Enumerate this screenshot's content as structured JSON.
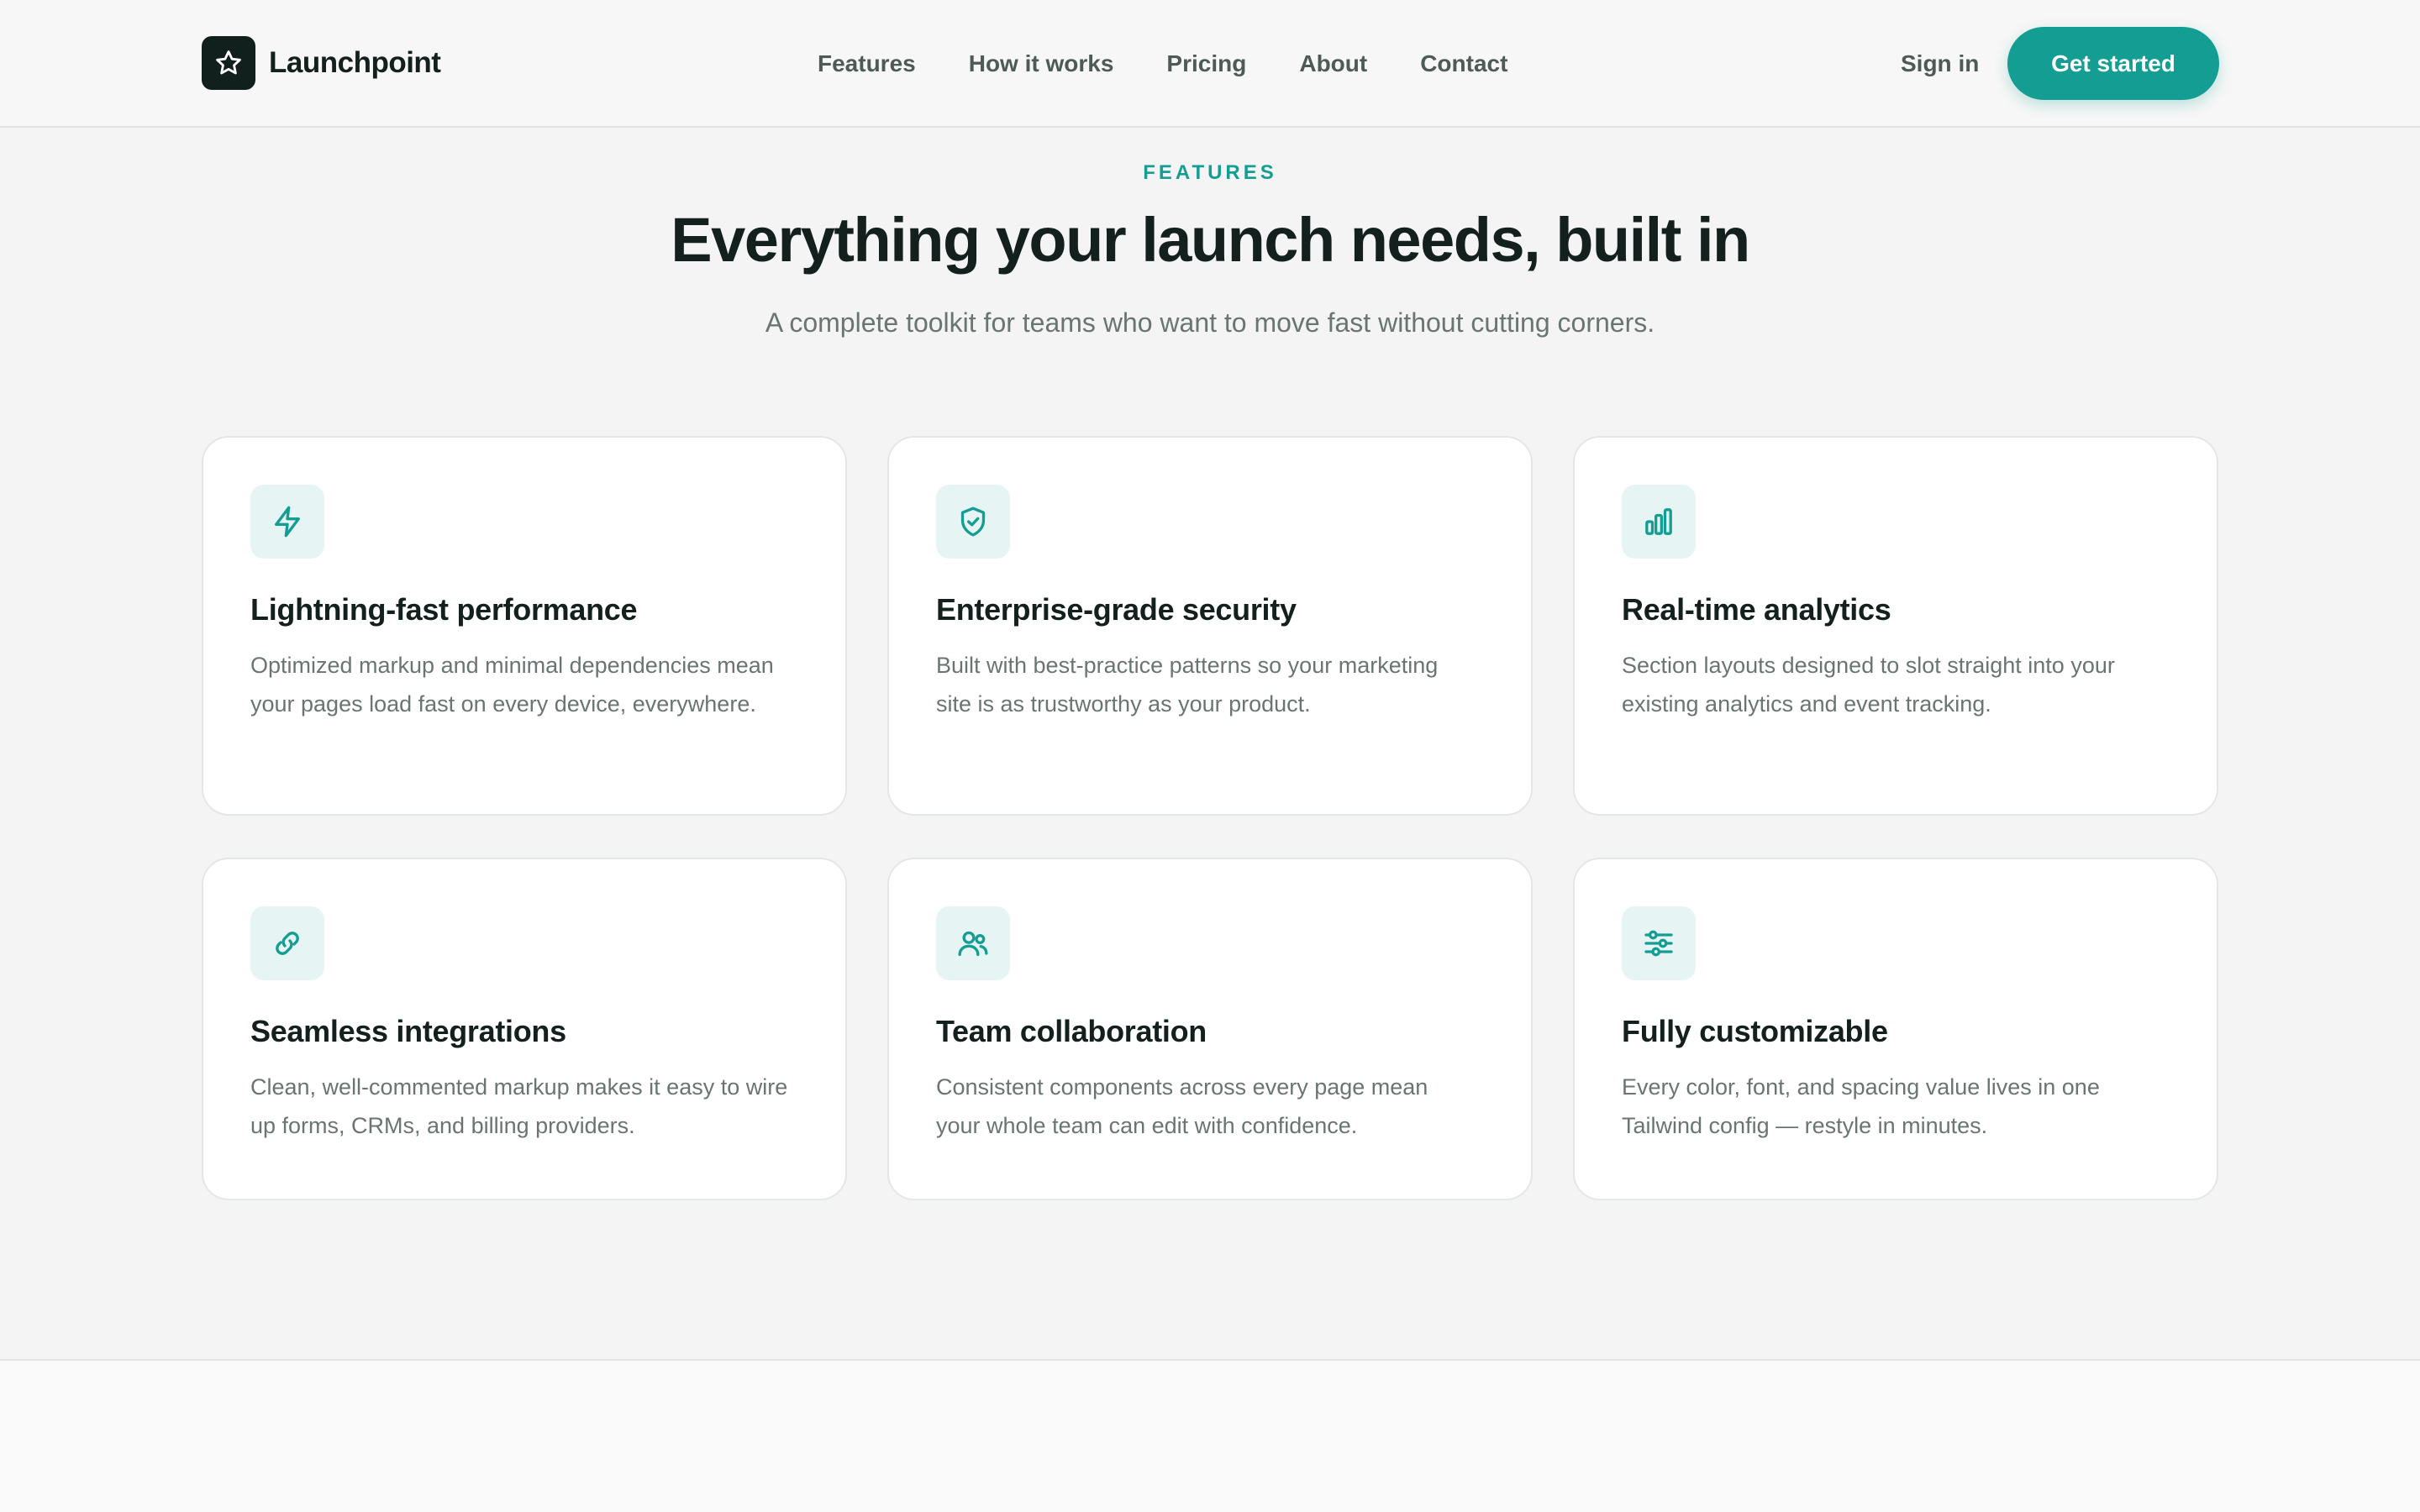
{
  "brand": {
    "name": "Launchpoint",
    "logo_icon": "star-icon",
    "accent_color": "#149d93",
    "dark_color": "#11201c"
  },
  "nav": {
    "items": [
      {
        "label": "Features"
      },
      {
        "label": "How it works"
      },
      {
        "label": "Pricing"
      },
      {
        "label": "About"
      },
      {
        "label": "Contact"
      }
    ],
    "sign_in": "Sign in",
    "cta": "Get started"
  },
  "features": {
    "eyebrow": "FEATURES",
    "title": "Everything your launch needs, built in",
    "subtitle": "A complete toolkit for teams who want to move fast without cutting corners.",
    "cards": [
      {
        "icon": "lightning-icon",
        "title": "Lightning-fast performance",
        "description": "Optimized markup and minimal dependencies mean your pages load fast on every device, everywhere."
      },
      {
        "icon": "shield-check-icon",
        "title": "Enterprise-grade security",
        "description": "Built with best-practice patterns so your marketing site is as trustworthy as your product."
      },
      {
        "icon": "bar-chart-icon",
        "title": "Real-time analytics",
        "description": "Section layouts designed to slot straight into your existing analytics and event tracking."
      },
      {
        "icon": "link-icon",
        "title": "Seamless integrations",
        "description": "Clean, well-commented markup makes it easy to wire up forms, CRMs, and billing providers."
      },
      {
        "icon": "users-icon",
        "title": "Team collaboration",
        "description": "Consistent components across every page mean your whole team can edit with confidence."
      },
      {
        "icon": "sliders-icon",
        "title": "Fully customizable",
        "description": "Every color, font, and spacing value lives in one Tailwind config — restyle in minutes."
      }
    ]
  }
}
